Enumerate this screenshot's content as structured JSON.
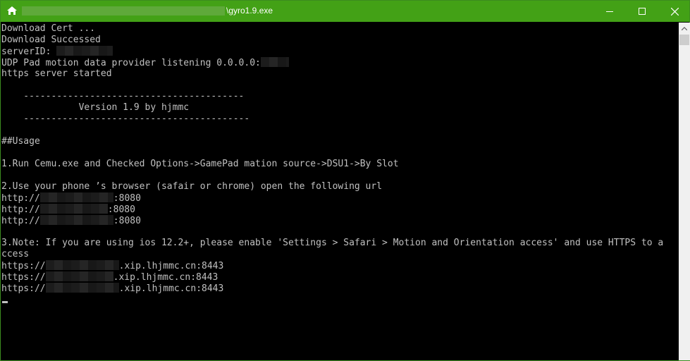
{
  "window": {
    "title": "\\gyro1.9.exe",
    "icons": {
      "app": "home-icon",
      "minimize": "minimize-icon",
      "maximize": "maximize-icon",
      "close": "close-icon"
    },
    "colors": {
      "titlebar": "#43a116",
      "console_bg": "#000000",
      "console_text": "#c0c0c0"
    }
  },
  "console": {
    "lines": [
      "Download Cert ...",
      "Download Successed",
      "serverID: ",
      "UDP Pad motion data provider listening 0.0.0.0:",
      "https server started",
      "    ----------------------------------------",
      "              Version 1.9 by hjmmc",
      "    -----------------------------------------",
      "##Usage",
      "1.Run Cemu.exe and Checked Options->GamePad mation source->DSU1->By Slot",
      "2.Use your phone ’s browser (safair or chrome) open the following url",
      "http://",
      ":8080",
      "3.Note: If you are using ios 12.2+, please enable 'Settings > Safari > Motion and Orientation access' and use HTTPS to a",
      "ccess",
      "https://",
      ".xip.lhjmmc.cn:8443"
    ]
  }
}
